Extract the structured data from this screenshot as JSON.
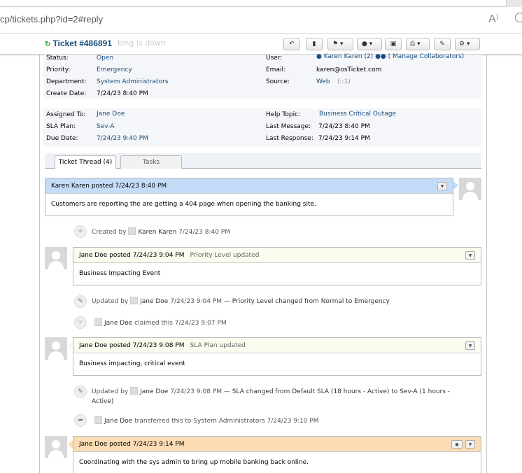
{
  "browser": {
    "url": "cp/tickets.php?id=2#reply",
    "read_aloud_icon": "A⁾"
  },
  "header": {
    "ticket_number": "Ticket #486891",
    "subject_ghost": "king is down",
    "toolbar": {
      "reply_icon": "reply-icon",
      "print_icon": "print-icon",
      "flag_icon": "flag-icon",
      "assign_icon": "user-icon",
      "archive_icon": "archive-icon",
      "printer_icon": "printer-icon",
      "edit_icon": "edit-icon",
      "settings_icon": "gear-icon"
    }
  },
  "info1": {
    "status_label": "Status:",
    "status": "Open",
    "priority_label": "Priority:",
    "priority": "Emergency",
    "department_label": "Department:",
    "department": "System Administrators",
    "create_label": "Create Date:",
    "create": "7/24/23 8:40 PM",
    "user_label": "User:",
    "user": "Karen Karen (2)",
    "collaborators": "( Manage Collaborators)",
    "email_label": "Email:",
    "email": "karen@osTicket.com",
    "source_label": "Source:",
    "source": "Web",
    "source_ip": "(::1)"
  },
  "info2": {
    "assigned_label": "Assigned To:",
    "assigned": "Jane Doe",
    "sla_label": "SLA Plan:",
    "sla": "Sev-A",
    "due_label": "Due Date:",
    "due": "7/24/23 9:40 PM",
    "topic_label": "Help Topic:",
    "topic": "Business Critical Outage",
    "lastmsg_label": "Last Message:",
    "lastmsg": "7/24/23 8:40 PM",
    "lastresp_label": "Last Response:",
    "lastresp": "7/24/23 9:14 PM"
  },
  "tabs": {
    "thread": "Ticket Thread (4)",
    "tasks": "Tasks"
  },
  "thread": {
    "m1": {
      "author": "Karen Karen",
      "verb": "posted",
      "time": "7/24/23 8:40 PM",
      "body": "Customers are reporting the are getting a 404 page when opening the banking site."
    },
    "e1": {
      "prefix": "Created by",
      "who": "Karen Karen",
      "time": "7/24/23 8:40 PM"
    },
    "m2": {
      "author": "Jane Doe",
      "verb": "posted",
      "time": "7/24/23 9:04 PM",
      "note": "Priority Level updated",
      "body": "Business Impacting Event"
    },
    "e2": {
      "prefix": "Updated by",
      "who": "Jane Doe",
      "time": "7/24/23 9:04 PM",
      "detail": "— Priority Level changed from Normal to Emergency"
    },
    "e3": {
      "who": "Jane Doe",
      "action": "claimed this",
      "time": "7/24/23 9:07 PM"
    },
    "m3": {
      "author": "Jane Doe",
      "verb": "posted",
      "time": "7/24/23 9:08 PM",
      "note": "SLA Plan updated",
      "body": "Business impacting, critical event"
    },
    "e4": {
      "prefix": "Updated by",
      "who": "Jane Doe",
      "time": "7/24/23 9:08 PM",
      "detail": "— SLA changed from Default SLA (18 hours - Active) to Sev-A (1 hours -",
      "detail2": "Active)"
    },
    "e5": {
      "who": "Jane Doe",
      "action": "transferred this to System Administrators",
      "time": "7/24/23 9:10 PM"
    },
    "m4": {
      "author": "Jane Doe",
      "verb": "posted",
      "time": "7/24/23 9:14 PM",
      "body": "Coordinating with the sys admin to bring up mobile banking back online."
    }
  },
  "colors": {
    "user_msg_head": "#c4dcf7",
    "note_head": "#fbfbef",
    "response_head": "#fbdcb4",
    "link": "#184e81"
  }
}
